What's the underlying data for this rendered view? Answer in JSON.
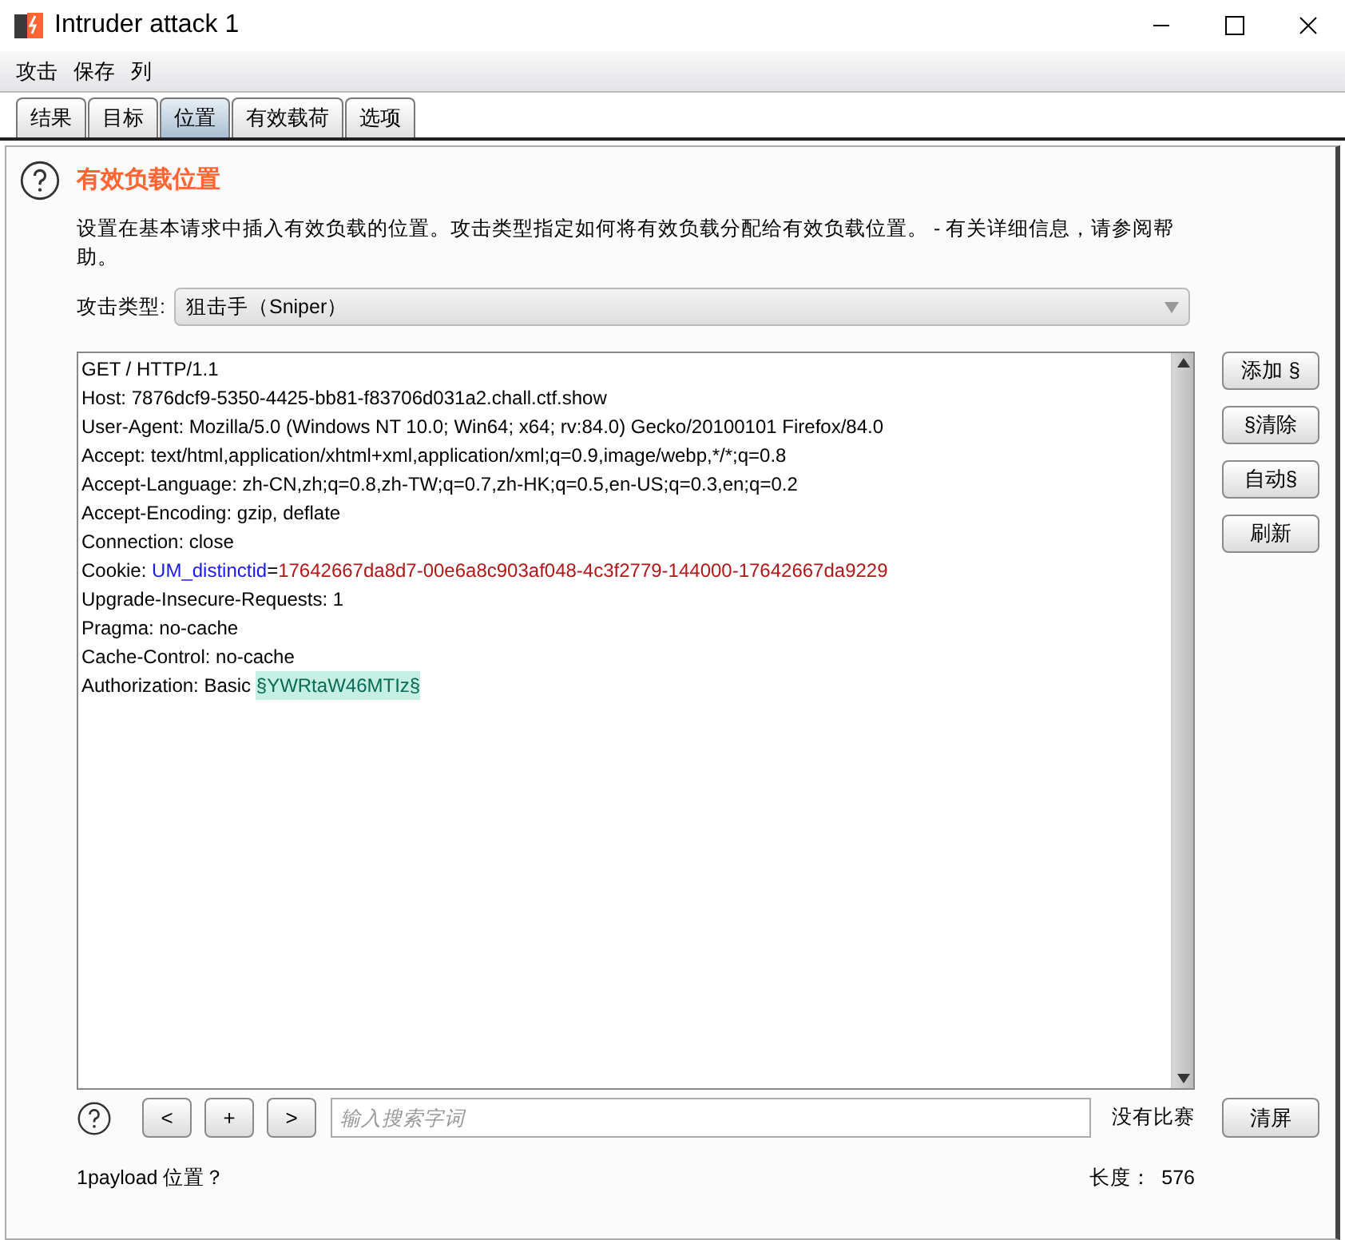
{
  "window": {
    "title": "Intruder attack 1"
  },
  "menu": [
    "攻击",
    "保存",
    "列"
  ],
  "tabs": [
    {
      "label": "结果",
      "selected": false
    },
    {
      "label": "目标",
      "selected": false
    },
    {
      "label": "位置",
      "selected": true
    },
    {
      "label": "有效载荷",
      "selected": false
    },
    {
      "label": "选项",
      "selected": false
    }
  ],
  "section": {
    "title": "有效负载位置",
    "description": "设置在基本请求中插入有效负载的位置。攻击类型指定如何将有效负载分配给有效负载位置。 - 有关详细信息，请参阅帮助。"
  },
  "attack_type": {
    "label": "攻击类型:",
    "value": "狙击手（Sniper）"
  },
  "request_lines": [
    [
      {
        "kind": "plain",
        "text": "GET / HTTP/1.1"
      }
    ],
    [
      {
        "kind": "plain",
        "text": "Host: 7876dcf9-5350-4425-bb81-f83706d031a2.chall.ctf.show"
      }
    ],
    [
      {
        "kind": "plain",
        "text": "User-Agent: Mozilla/5.0 (Windows NT 10.0; Win64; x64; rv:84.0) Gecko/20100101 Firefox/84.0"
      }
    ],
    [
      {
        "kind": "plain",
        "text": "Accept: text/html,application/xhtml+xml,application/xml;q=0.9,image/webp,*/*;q=0.8"
      }
    ],
    [
      {
        "kind": "plain",
        "text": "Accept-Language: zh-CN,zh;q=0.8,zh-TW;q=0.7,zh-HK;q=0.5,en-US;q=0.3,en;q=0.2"
      }
    ],
    [
      {
        "kind": "plain",
        "text": "Accept-Encoding: gzip, deflate"
      }
    ],
    [
      {
        "kind": "plain",
        "text": "Connection: close"
      }
    ],
    [
      {
        "kind": "plain",
        "text": "Cookie: "
      },
      {
        "kind": "param_name",
        "text": "UM_distinctid"
      },
      {
        "kind": "plain",
        "text": "="
      },
      {
        "kind": "param_value",
        "text": "17642667da8d7-00e6a8c903af048-4c3f2779-144000-17642667da9229"
      }
    ],
    [
      {
        "kind": "plain",
        "text": "Upgrade-Insecure-Requests: 1"
      }
    ],
    [
      {
        "kind": "plain",
        "text": "Pragma: no-cache"
      }
    ],
    [
      {
        "kind": "plain",
        "text": "Cache-Control: no-cache"
      }
    ],
    [
      {
        "kind": "plain",
        "text": "Authorization: Basic "
      },
      {
        "kind": "payload",
        "text": "§YWRtaW46MTIz§"
      }
    ]
  ],
  "side_buttons": [
    "添加 §",
    "§清除",
    "自动§",
    "刷新"
  ],
  "search": {
    "nav_buttons": [
      "<",
      "+",
      ">"
    ],
    "placeholder": "输入搜索字词",
    "match_status": "没有比赛",
    "clear_button": "清屏"
  },
  "footer": {
    "positions": "1payload 位置？",
    "length_label": "长度：",
    "length_value": "576"
  }
}
